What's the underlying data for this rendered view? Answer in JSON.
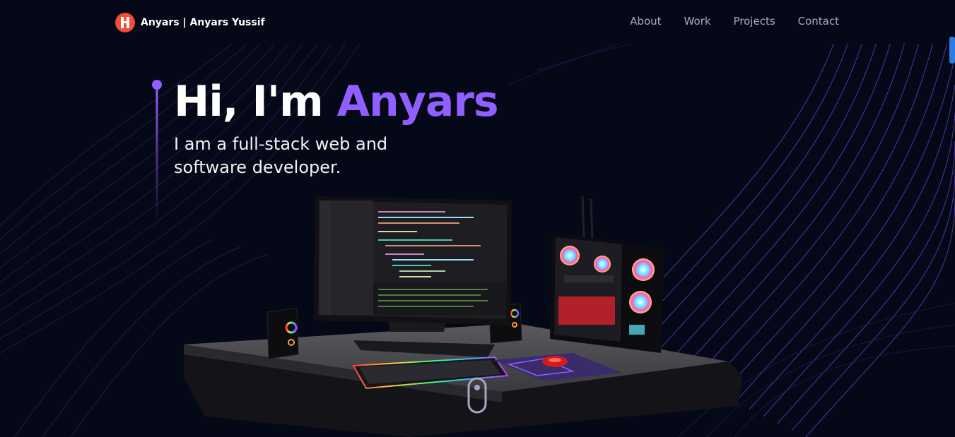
{
  "navbar": {
    "brand": "Anyars  |  Anyars Yussif",
    "links": [
      "About",
      "Work",
      "Projects",
      "Contact"
    ]
  },
  "hero": {
    "greeting": "Hi, I'm",
    "name": "Anyars",
    "subtitle": "I am a full-stack web and software developer."
  },
  "icons": {
    "logo": "logo-h-icon",
    "scroll": "mouse-scroll-icon"
  },
  "colors": {
    "background": "#050816",
    "accent": "#915eff",
    "nav_text": "#aaa6c3",
    "logo": "#f04d3a"
  }
}
